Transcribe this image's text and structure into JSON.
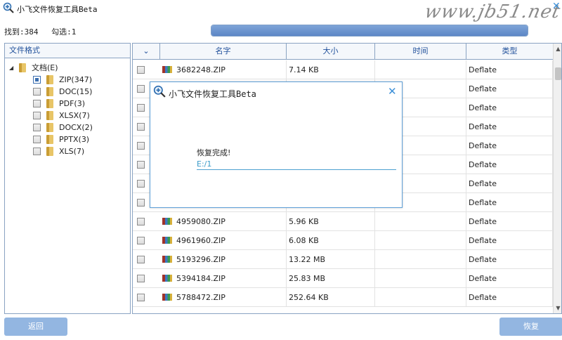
{
  "window": {
    "title": "小飞文件恢复工具Beta",
    "watermark": "www.jb51.net"
  },
  "stats": {
    "found_label": "找到:384",
    "checked_label": "勾选:1"
  },
  "progress": {
    "fraction": 1.0
  },
  "tree": {
    "header": "文件格式",
    "root": "文档(E)",
    "items": [
      {
        "label": "ZIP(347)",
        "checked": true
      },
      {
        "label": "DOC(15)",
        "checked": false
      },
      {
        "label": "PDF(3)",
        "checked": false
      },
      {
        "label": "XLSX(7)",
        "checked": false
      },
      {
        "label": "DOCX(2)",
        "checked": false
      },
      {
        "label": "PPTX(3)",
        "checked": false
      },
      {
        "label": "XLS(7)",
        "checked": false
      }
    ]
  },
  "grid": {
    "columns": {
      "check": "⌄",
      "name": "名字",
      "size": "大小",
      "time": "时间",
      "type": "类型"
    },
    "rows": [
      {
        "name": "3682248.ZIP",
        "size": "7.14 KB",
        "time": "",
        "type": "Deflate"
      },
      {
        "name": "",
        "size": "",
        "time": "",
        "type": "Deflate"
      },
      {
        "name": "",
        "size": "",
        "time": "",
        "type": "Deflate"
      },
      {
        "name": "",
        "size": "",
        "time": "",
        "type": "Deflate"
      },
      {
        "name": "",
        "size": "",
        "time": "",
        "type": "Deflate"
      },
      {
        "name": "",
        "size": "",
        "time": "",
        "type": "Deflate"
      },
      {
        "name": "",
        "size": "",
        "time": "",
        "type": "Deflate"
      },
      {
        "name": "",
        "size": "",
        "time": "",
        "type": "Deflate"
      },
      {
        "name": "4959080.ZIP",
        "size": "5.96 KB",
        "time": "",
        "type": "Deflate"
      },
      {
        "name": "4961960.ZIP",
        "size": "6.08 KB",
        "time": "",
        "type": "Deflate"
      },
      {
        "name": "5193296.ZIP",
        "size": "13.22 MB",
        "time": "",
        "type": "Deflate"
      },
      {
        "name": "5394184.ZIP",
        "size": "25.83 MB",
        "time": "",
        "type": "Deflate"
      },
      {
        "name": "5788472.ZIP",
        "size": "252.64 KB",
        "time": "",
        "type": "Deflate"
      }
    ]
  },
  "dialog": {
    "title": "小飞文件恢复工具Beta",
    "message": "恢复完成!",
    "path": "E:/1"
  },
  "buttons": {
    "back": "返回",
    "recover": "恢复"
  },
  "colors": {
    "accent": "#3b8fd8",
    "button": "#93b6e1",
    "header_text": "#1f4f9a"
  }
}
